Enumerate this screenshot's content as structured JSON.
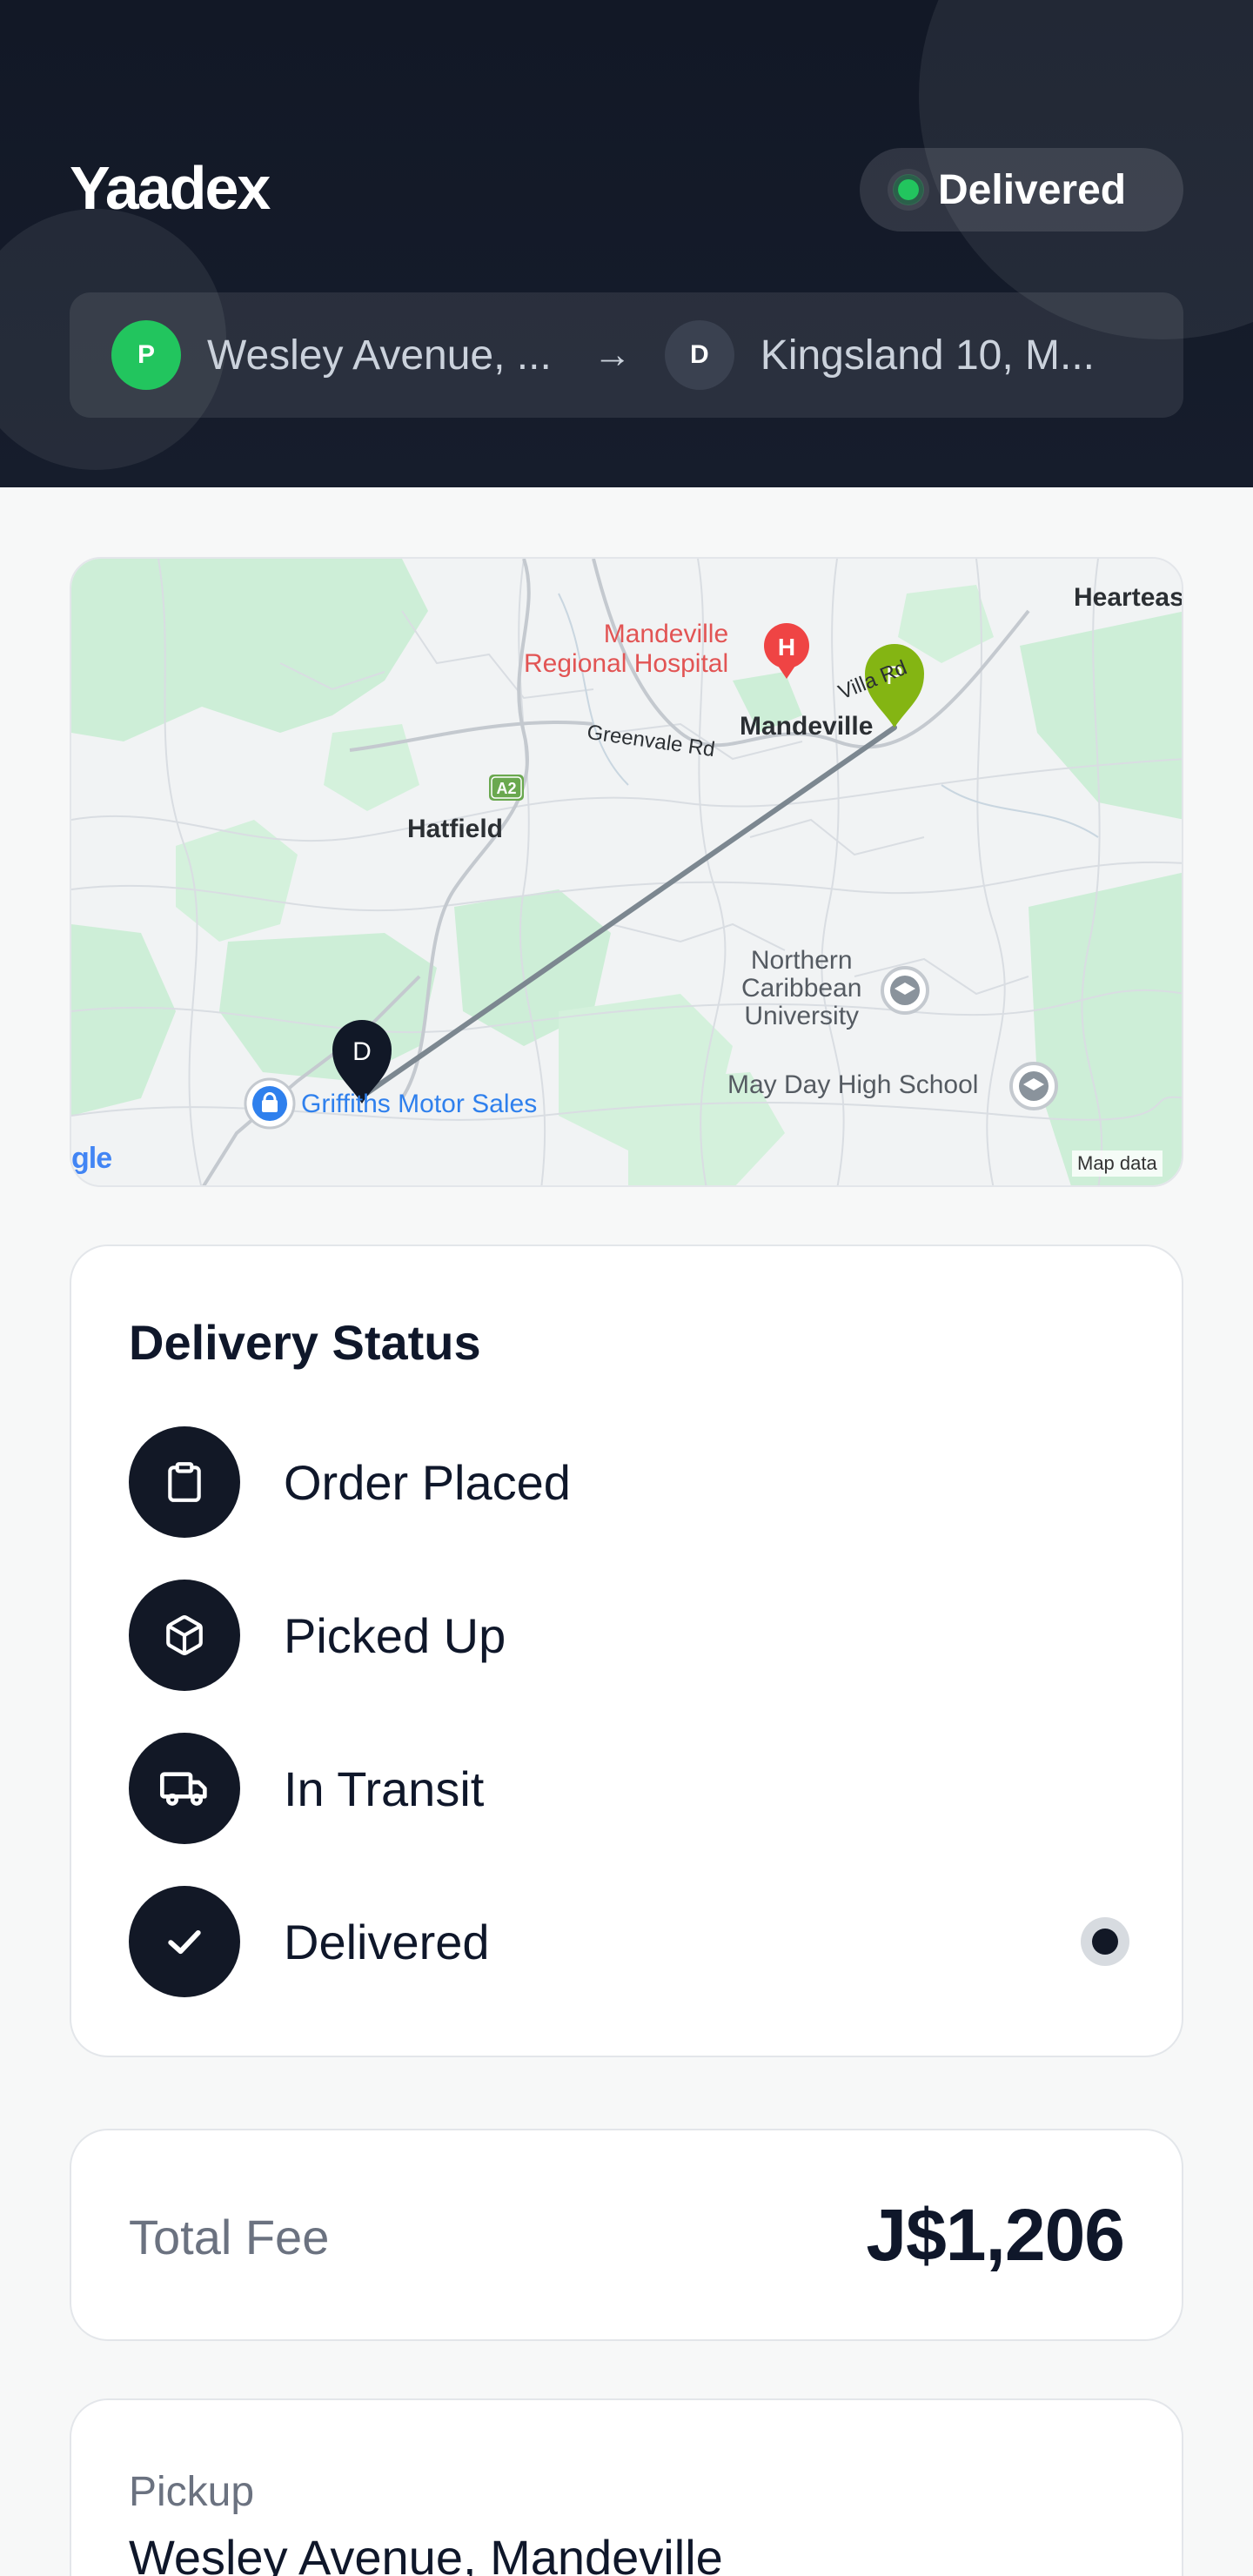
{
  "header": {
    "brand": "Yaadex",
    "status": "Delivered",
    "pickup_badge": "P",
    "pickup_short": "Wesley Avenue, ...",
    "arrow": "→",
    "dropoff_badge": "D",
    "dropoff_short": "Kingsland 10, M..."
  },
  "map": {
    "labels": {
      "heartease": "Heartease",
      "hospital_line1": "Mandeville",
      "hospital_line2": "Regional Hospital",
      "hospital_marker": "H",
      "villa_rd": "Villa Rd",
      "mandeville": "Mandeville",
      "greenvale": "Greenvale Rd",
      "a2": "A2",
      "hatfield": "Hatfield",
      "ncu_line1": "Northern",
      "ncu_line2": "Caribbean",
      "ncu_line3": "University",
      "mayday": "May Day High School",
      "griffiths": "Griffiths Motor Sales",
      "google": "gle",
      "attribution": "Map data"
    },
    "pickup_marker": "P",
    "dropoff_marker": "D",
    "colors": {
      "route": "#7c8790",
      "pickup_pin": "#84b513",
      "dropoff_pin": "#111827",
      "park": "#cdeed7"
    }
  },
  "delivery_status": {
    "title": "Delivery Status",
    "steps": [
      {
        "label": "Order Placed",
        "icon": "clipboard-icon"
      },
      {
        "label": "Picked Up",
        "icon": "package-icon"
      },
      {
        "label": "In Transit",
        "icon": "truck-icon"
      },
      {
        "label": "Delivered",
        "icon": "check-icon"
      }
    ],
    "current_step": "Delivered"
  },
  "fee": {
    "label": "Total Fee",
    "value": "J$1,206"
  },
  "pickup": {
    "label": "Pickup",
    "value": "Wesley Avenue, Mandeville"
  },
  "colors": {
    "header_bg": "#121826",
    "accent_green": "#22c55e",
    "step_icon_bg": "#121826"
  }
}
